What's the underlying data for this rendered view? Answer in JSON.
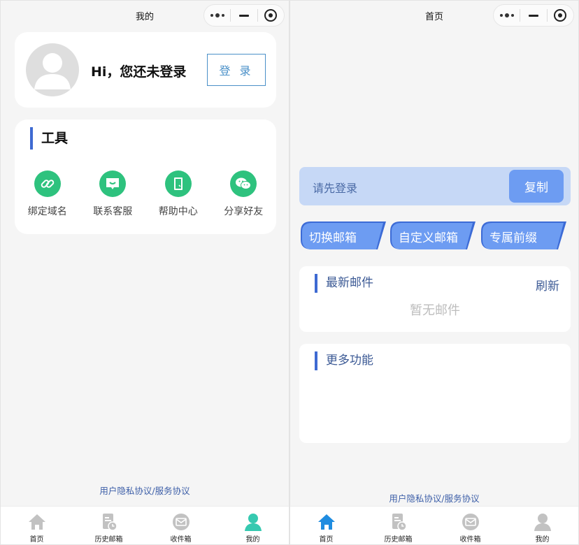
{
  "left_page": {
    "nav_title": "我的",
    "profile": {
      "greeting": "Hi，您还未登录",
      "login_button": "登 录"
    },
    "tools": {
      "title": "工具",
      "items": [
        {
          "label": "绑定域名",
          "icon": "link-icon"
        },
        {
          "label": "联系客服",
          "icon": "chat-bubble-icon"
        },
        {
          "label": "帮助中心",
          "icon": "book-icon"
        },
        {
          "label": "分享好友",
          "icon": "wechat-icon"
        }
      ]
    },
    "agreement": "用户隐私协议/服务协议"
  },
  "right_page": {
    "nav_title": "首页",
    "email_bar": {
      "placeholder": "请先登录",
      "copy_button": "复制"
    },
    "actions": [
      "切换邮箱",
      "自定义邮箱",
      "专属前缀"
    ],
    "latest_mail": {
      "title": "最新邮件",
      "refresh": "刷新",
      "empty": "暂无邮件"
    },
    "more": {
      "title": "更多功能"
    },
    "agreement": "用户隐私协议/服务协议"
  },
  "tabbar": {
    "items": [
      {
        "label": "首页",
        "icon": "home-icon"
      },
      {
        "label": "历史邮箱",
        "icon": "history-icon"
      },
      {
        "label": "收件箱",
        "icon": "inbox-icon"
      },
      {
        "label": "我的",
        "icon": "profile-icon"
      }
    ],
    "left_active": 3,
    "right_active": 0
  },
  "colors": {
    "accent_blue": "#3e6ad2",
    "tool_green": "#2ec27e",
    "copy_bar_bg": "#c6d8f6",
    "copy_button": "#6d9cf2",
    "action_button": "#6d9cf2",
    "tab_active_left": "#36c9b0",
    "tab_active_right": "#1f8ce0",
    "tab_inactive": "#c2c2c2"
  }
}
